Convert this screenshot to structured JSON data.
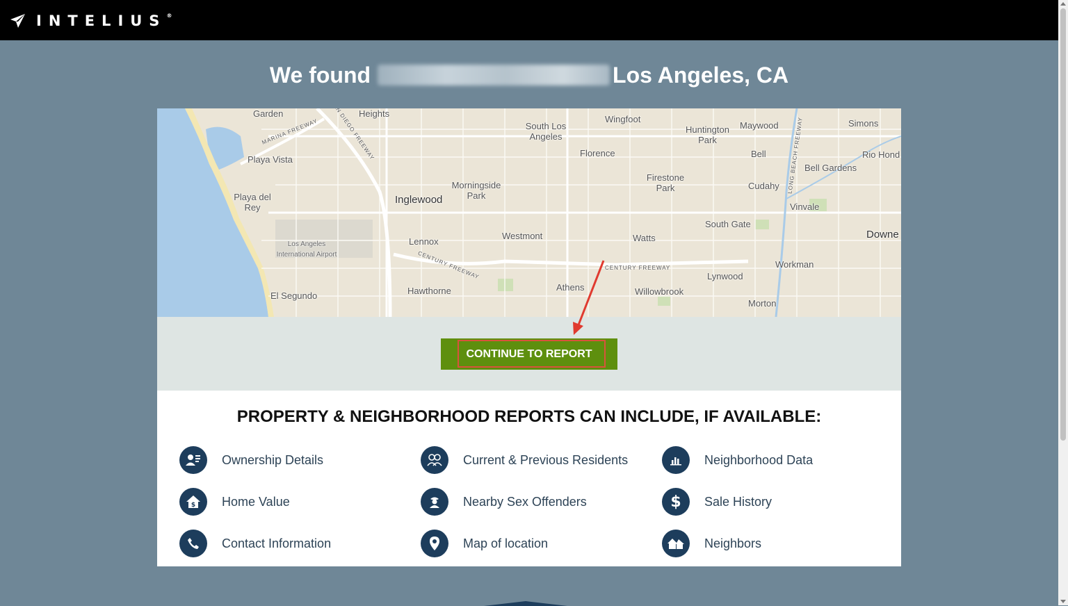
{
  "brand": {
    "name": "INTELIUS"
  },
  "headline": {
    "prefix": "We found",
    "location": "Los Angeles, CA"
  },
  "map": {
    "labels": [
      "Garden",
      "Heights",
      "Wingfoot",
      "South Los Angeles",
      "Huntington Park",
      "Maywood",
      "Simons",
      "Rio Hond",
      "Playa Vista",
      "Florence",
      "Bell",
      "Bell Gardens",
      "Playa del Rey",
      "Morningside Park",
      "Inglewood",
      "Firestone Park",
      "Cudahy",
      "Vinvale",
      "South Gate",
      "Downe",
      "Los Angeles International Airport",
      "Lennox",
      "Westmont",
      "Watts",
      "Workman",
      "Lynwood",
      "Hawthorne",
      "Athens",
      "Willowbrook",
      "El Segundo",
      "Morton"
    ],
    "roads": [
      "MARINA FREEWAY",
      "SAN DIEGO FREEWAY",
      "CENTURY FREEWAY",
      "LONG BEACH FREEWAY"
    ]
  },
  "cta": {
    "label": "CONTINUE TO REPORT"
  },
  "features": {
    "title": "PROPERTY & NEIGHBORHOOD REPORTS CAN INCLUDE, IF AVAILABLE:",
    "items": [
      {
        "label": "Ownership Details",
        "icon": "ownership-icon"
      },
      {
        "label": "Current & Previous Residents",
        "icon": "residents-icon"
      },
      {
        "label": "Neighborhood Data",
        "icon": "bar-chart-icon"
      },
      {
        "label": "Home Value",
        "icon": "home-dollar-icon"
      },
      {
        "label": "Nearby Sex Offenders",
        "icon": "offender-icon"
      },
      {
        "label": "Sale History",
        "icon": "dollar-icon"
      },
      {
        "label": "Contact Information",
        "icon": "phone-icon"
      },
      {
        "label": "Map of location",
        "icon": "map-pin-icon"
      },
      {
        "label": "Neighbors",
        "icon": "houses-icon"
      }
    ]
  },
  "colors": {
    "accent": "#5e8f0e",
    "icon_bg": "#1d3d5c",
    "page_bg": "#6f8797",
    "highlight": "#d9533c"
  }
}
